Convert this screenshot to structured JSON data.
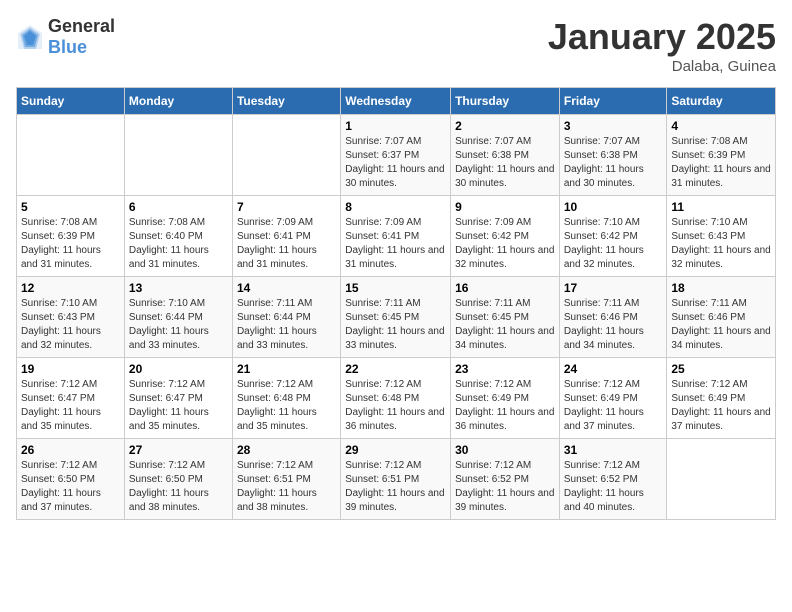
{
  "header": {
    "logo_general": "General",
    "logo_blue": "Blue",
    "title": "January 2025",
    "location": "Dalaba, Guinea"
  },
  "weekdays": [
    "Sunday",
    "Monday",
    "Tuesday",
    "Wednesday",
    "Thursday",
    "Friday",
    "Saturday"
  ],
  "weeks": [
    [
      {
        "day": "",
        "sunrise": "",
        "sunset": "",
        "daylight": ""
      },
      {
        "day": "",
        "sunrise": "",
        "sunset": "",
        "daylight": ""
      },
      {
        "day": "",
        "sunrise": "",
        "sunset": "",
        "daylight": ""
      },
      {
        "day": "1",
        "sunrise": "Sunrise: 7:07 AM",
        "sunset": "Sunset: 6:37 PM",
        "daylight": "Daylight: 11 hours and 30 minutes."
      },
      {
        "day": "2",
        "sunrise": "Sunrise: 7:07 AM",
        "sunset": "Sunset: 6:38 PM",
        "daylight": "Daylight: 11 hours and 30 minutes."
      },
      {
        "day": "3",
        "sunrise": "Sunrise: 7:07 AM",
        "sunset": "Sunset: 6:38 PM",
        "daylight": "Daylight: 11 hours and 30 minutes."
      },
      {
        "day": "4",
        "sunrise": "Sunrise: 7:08 AM",
        "sunset": "Sunset: 6:39 PM",
        "daylight": "Daylight: 11 hours and 31 minutes."
      }
    ],
    [
      {
        "day": "5",
        "sunrise": "Sunrise: 7:08 AM",
        "sunset": "Sunset: 6:39 PM",
        "daylight": "Daylight: 11 hours and 31 minutes."
      },
      {
        "day": "6",
        "sunrise": "Sunrise: 7:08 AM",
        "sunset": "Sunset: 6:40 PM",
        "daylight": "Daylight: 11 hours and 31 minutes."
      },
      {
        "day": "7",
        "sunrise": "Sunrise: 7:09 AM",
        "sunset": "Sunset: 6:41 PM",
        "daylight": "Daylight: 11 hours and 31 minutes."
      },
      {
        "day": "8",
        "sunrise": "Sunrise: 7:09 AM",
        "sunset": "Sunset: 6:41 PM",
        "daylight": "Daylight: 11 hours and 31 minutes."
      },
      {
        "day": "9",
        "sunrise": "Sunrise: 7:09 AM",
        "sunset": "Sunset: 6:42 PM",
        "daylight": "Daylight: 11 hours and 32 minutes."
      },
      {
        "day": "10",
        "sunrise": "Sunrise: 7:10 AM",
        "sunset": "Sunset: 6:42 PM",
        "daylight": "Daylight: 11 hours and 32 minutes."
      },
      {
        "day": "11",
        "sunrise": "Sunrise: 7:10 AM",
        "sunset": "Sunset: 6:43 PM",
        "daylight": "Daylight: 11 hours and 32 minutes."
      }
    ],
    [
      {
        "day": "12",
        "sunrise": "Sunrise: 7:10 AM",
        "sunset": "Sunset: 6:43 PM",
        "daylight": "Daylight: 11 hours and 32 minutes."
      },
      {
        "day": "13",
        "sunrise": "Sunrise: 7:10 AM",
        "sunset": "Sunset: 6:44 PM",
        "daylight": "Daylight: 11 hours and 33 minutes."
      },
      {
        "day": "14",
        "sunrise": "Sunrise: 7:11 AM",
        "sunset": "Sunset: 6:44 PM",
        "daylight": "Daylight: 11 hours and 33 minutes."
      },
      {
        "day": "15",
        "sunrise": "Sunrise: 7:11 AM",
        "sunset": "Sunset: 6:45 PM",
        "daylight": "Daylight: 11 hours and 33 minutes."
      },
      {
        "day": "16",
        "sunrise": "Sunrise: 7:11 AM",
        "sunset": "Sunset: 6:45 PM",
        "daylight": "Daylight: 11 hours and 34 minutes."
      },
      {
        "day": "17",
        "sunrise": "Sunrise: 7:11 AM",
        "sunset": "Sunset: 6:46 PM",
        "daylight": "Daylight: 11 hours and 34 minutes."
      },
      {
        "day": "18",
        "sunrise": "Sunrise: 7:11 AM",
        "sunset": "Sunset: 6:46 PM",
        "daylight": "Daylight: 11 hours and 34 minutes."
      }
    ],
    [
      {
        "day": "19",
        "sunrise": "Sunrise: 7:12 AM",
        "sunset": "Sunset: 6:47 PM",
        "daylight": "Daylight: 11 hours and 35 minutes."
      },
      {
        "day": "20",
        "sunrise": "Sunrise: 7:12 AM",
        "sunset": "Sunset: 6:47 PM",
        "daylight": "Daylight: 11 hours and 35 minutes."
      },
      {
        "day": "21",
        "sunrise": "Sunrise: 7:12 AM",
        "sunset": "Sunset: 6:48 PM",
        "daylight": "Daylight: 11 hours and 35 minutes."
      },
      {
        "day": "22",
        "sunrise": "Sunrise: 7:12 AM",
        "sunset": "Sunset: 6:48 PM",
        "daylight": "Daylight: 11 hours and 36 minutes."
      },
      {
        "day": "23",
        "sunrise": "Sunrise: 7:12 AM",
        "sunset": "Sunset: 6:49 PM",
        "daylight": "Daylight: 11 hours and 36 minutes."
      },
      {
        "day": "24",
        "sunrise": "Sunrise: 7:12 AM",
        "sunset": "Sunset: 6:49 PM",
        "daylight": "Daylight: 11 hours and 37 minutes."
      },
      {
        "day": "25",
        "sunrise": "Sunrise: 7:12 AM",
        "sunset": "Sunset: 6:49 PM",
        "daylight": "Daylight: 11 hours and 37 minutes."
      }
    ],
    [
      {
        "day": "26",
        "sunrise": "Sunrise: 7:12 AM",
        "sunset": "Sunset: 6:50 PM",
        "daylight": "Daylight: 11 hours and 37 minutes."
      },
      {
        "day": "27",
        "sunrise": "Sunrise: 7:12 AM",
        "sunset": "Sunset: 6:50 PM",
        "daylight": "Daylight: 11 hours and 38 minutes."
      },
      {
        "day": "28",
        "sunrise": "Sunrise: 7:12 AM",
        "sunset": "Sunset: 6:51 PM",
        "daylight": "Daylight: 11 hours and 38 minutes."
      },
      {
        "day": "29",
        "sunrise": "Sunrise: 7:12 AM",
        "sunset": "Sunset: 6:51 PM",
        "daylight": "Daylight: 11 hours and 39 minutes."
      },
      {
        "day": "30",
        "sunrise": "Sunrise: 7:12 AM",
        "sunset": "Sunset: 6:52 PM",
        "daylight": "Daylight: 11 hours and 39 minutes."
      },
      {
        "day": "31",
        "sunrise": "Sunrise: 7:12 AM",
        "sunset": "Sunset: 6:52 PM",
        "daylight": "Daylight: 11 hours and 40 minutes."
      },
      {
        "day": "",
        "sunrise": "",
        "sunset": "",
        "daylight": ""
      }
    ]
  ]
}
